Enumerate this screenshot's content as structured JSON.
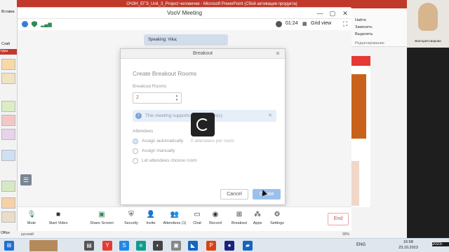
{
  "window": {
    "title": "VooV Meeting",
    "ppt_title": "ОЧЗН_ЕГЭ_Unit_3_Project человечек - Microsoft PowerPoint (Сбой активации продукта)",
    "minimize": "—",
    "maximize": "▢",
    "close": "✕"
  },
  "status_bar": {
    "timer": "01:24",
    "grid_view": "Grid view"
  },
  "speaking": "Speaking: Vika;",
  "dialog": {
    "header": "Breakout",
    "title": "Create Breakout Rooms",
    "rooms_label": "Breakout Rooms",
    "rooms_value": "2",
    "info_text": "This meeting supports up to 2 room(s).",
    "attendees_label": "Attendees",
    "options": [
      {
        "label": "Assign automatically",
        "selected": true
      },
      {
        "label": "Assign manually",
        "selected": false
      },
      {
        "label": "Let attendees choose room",
        "selected": false
      }
    ],
    "per_room_hint": "0  attendees per room",
    "cancel": "Cancel",
    "create": "Create"
  },
  "toolbar": {
    "items": [
      {
        "label": "Mute",
        "icon": "microphone-icon"
      },
      {
        "label": "Start Video",
        "icon": "camera-icon"
      },
      {
        "label": "Share Screen",
        "icon": "share-screen-icon"
      },
      {
        "label": "Security",
        "icon": "shield-icon"
      },
      {
        "label": "Invite",
        "icon": "invite-icon"
      },
      {
        "label": "Attendees (1)",
        "icon": "attendees-icon"
      },
      {
        "label": "Chat",
        "icon": "chat-icon"
      },
      {
        "label": "Record",
        "icon": "record-icon"
      },
      {
        "label": "Breakout",
        "icon": "breakout-icon"
      },
      {
        "label": "Apps",
        "icon": "apps-icon"
      },
      {
        "label": "Settings",
        "icon": "gear-icon"
      }
    ],
    "end": "End"
  },
  "ppt": {
    "ribbon": [
      "Найти",
      "Заменить",
      "Выделить"
    ],
    "ribbon_group": "Редактирование",
    "left_tab": "туры",
    "paste": "Вставка",
    "slides": "Слай",
    "zoom": "90%",
    "language": "русский",
    "office_tab": "Office"
  },
  "webcam": {
    "name": "Виктория Шарова"
  },
  "taskbar": {
    "lang": "ENG",
    "time": "16:58",
    "date": "23.10.2023",
    "edge_text": "2023-"
  },
  "colors": {
    "accent": "#9cc0ec",
    "end_red": "#d24a4a",
    "ppt_red": "#c0392b"
  }
}
